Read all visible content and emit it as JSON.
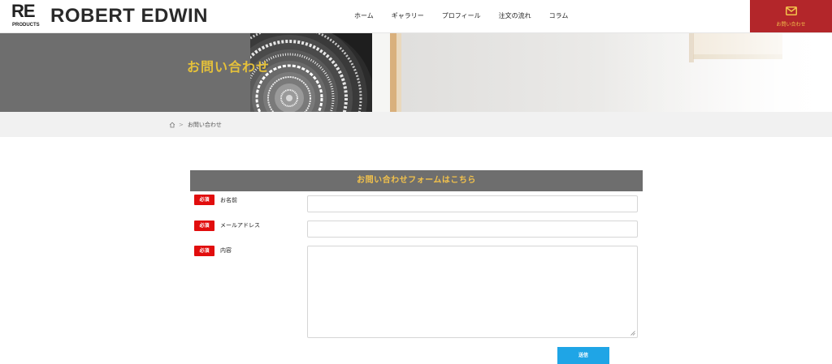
{
  "header": {
    "logo_top": "RE",
    "logo_bottom": "PRODUCTS",
    "brand": "ROBERT EDWIN",
    "nav": [
      "ホーム",
      "ギャラリー",
      "プロフィール",
      "注文の流れ",
      "コラム"
    ],
    "contact_button": "お問い合わせ",
    "contact_icon": "mail-icon"
  },
  "hero": {
    "title": "お問い合わせ"
  },
  "breadcrumb": {
    "home_icon": "home-icon",
    "current": "お問い合わせ"
  },
  "form": {
    "heading": "お問い合わせフォームはこちら",
    "required_badge": "必須",
    "fields": [
      {
        "label": "お名前",
        "value": ""
      },
      {
        "label": "メールアドレス",
        "value": ""
      },
      {
        "label": "内容",
        "value": ""
      }
    ],
    "submit": "送信"
  },
  "colors": {
    "accent_red": "#b3262a",
    "badge_red": "#e10d0d",
    "gold": "#e5c13a",
    "submit_blue": "#1fa5e6",
    "header_gray": "#6e6e6e"
  }
}
